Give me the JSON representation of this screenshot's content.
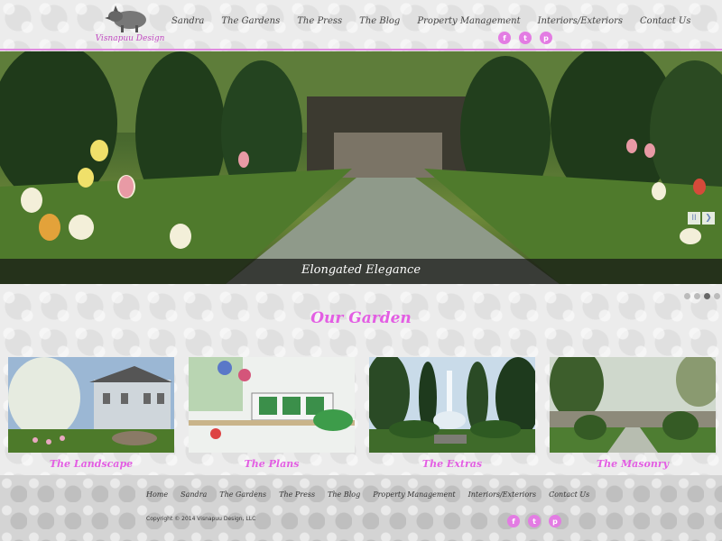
{
  "brand": {
    "logo_text": "Visnapuu Design"
  },
  "nav": {
    "items": [
      "Sandra",
      "The Gardens",
      "The Press",
      "The Blog",
      "Property Management",
      "Interiors/Exteriors",
      "Contact Us"
    ]
  },
  "social": {
    "facebook": "f",
    "twitter": "t",
    "pinterest": "p"
  },
  "hero": {
    "caption": "Elongated Elegance",
    "controls": {
      "pause": "II",
      "next": "❯"
    },
    "slide_count": 4,
    "active_slide": 2
  },
  "section": {
    "title": "Our Garden"
  },
  "cards": [
    {
      "label": "The Landscape"
    },
    {
      "label": "The Plans"
    },
    {
      "label": "The Extras"
    },
    {
      "label": "The Masonry"
    }
  ],
  "footer": {
    "nav": [
      "Home",
      "Sandra",
      "The Gardens",
      "The Press",
      "The Blog",
      "Property Management",
      "Interiors/Exteriors",
      "Contact Us"
    ],
    "copyright": "Copyright © 2014 Visnapuu Design, LLC"
  },
  "colors": {
    "accent": "#e35ee3",
    "border": "#e08be0"
  }
}
